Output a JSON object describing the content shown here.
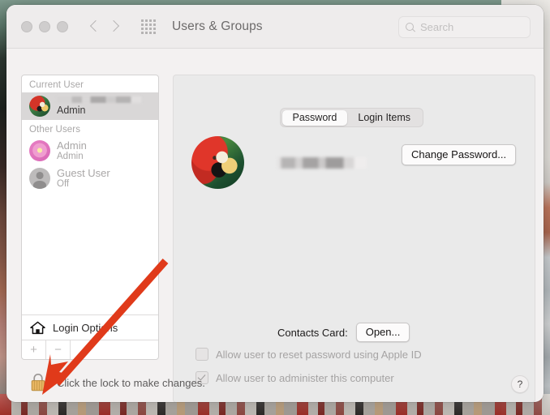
{
  "window": {
    "title": "Users & Groups",
    "traffic_lights": [
      "close",
      "minimize",
      "zoom"
    ],
    "nav": {
      "back": "‹",
      "forward": "›"
    },
    "grid_icon": "show-all-grid-icon",
    "search": {
      "placeholder": "Search",
      "value": "",
      "icon": "search-icon"
    }
  },
  "sidebar": {
    "groups": [
      {
        "header": "Current User",
        "users": [
          {
            "name": "",
            "name_redacted": true,
            "role": "Admin",
            "avatar": "parrot-avatar",
            "selected": true
          }
        ]
      },
      {
        "header": "Other Users",
        "users": [
          {
            "name": "Admin",
            "name_redacted": false,
            "role": "Admin",
            "avatar": "flower-avatar",
            "selected": false
          },
          {
            "name": "Guest User",
            "name_redacted": false,
            "role": "Off",
            "avatar": "guest-avatar",
            "selected": false
          }
        ]
      }
    ],
    "login_options": {
      "label": "Login Options",
      "icon": "home-icon"
    },
    "add_button": "+",
    "remove_button": "−"
  },
  "content": {
    "tabs": [
      {
        "label": "Password",
        "active": true
      },
      {
        "label": "Login Items",
        "active": false
      }
    ],
    "account": {
      "avatar": "parrot-avatar",
      "full_name": "",
      "full_name_redacted": true,
      "change_password_button": "Change Password..."
    },
    "contacts_card": {
      "label": "Contacts Card:",
      "open_button": "Open..."
    },
    "checkboxes": [
      {
        "label": "Allow user to reset password using Apple ID",
        "checked": false,
        "enabled": false
      },
      {
        "label": "Allow user to administer this computer",
        "checked": true,
        "enabled": false
      }
    ]
  },
  "footer": {
    "lock_icon": "lock-closed-icon",
    "lock_message": "Click the lock to make changes.",
    "help_button": "?"
  },
  "annotation": {
    "arrow_color": "#e03a1a",
    "arrow_target": "lock-icon"
  }
}
